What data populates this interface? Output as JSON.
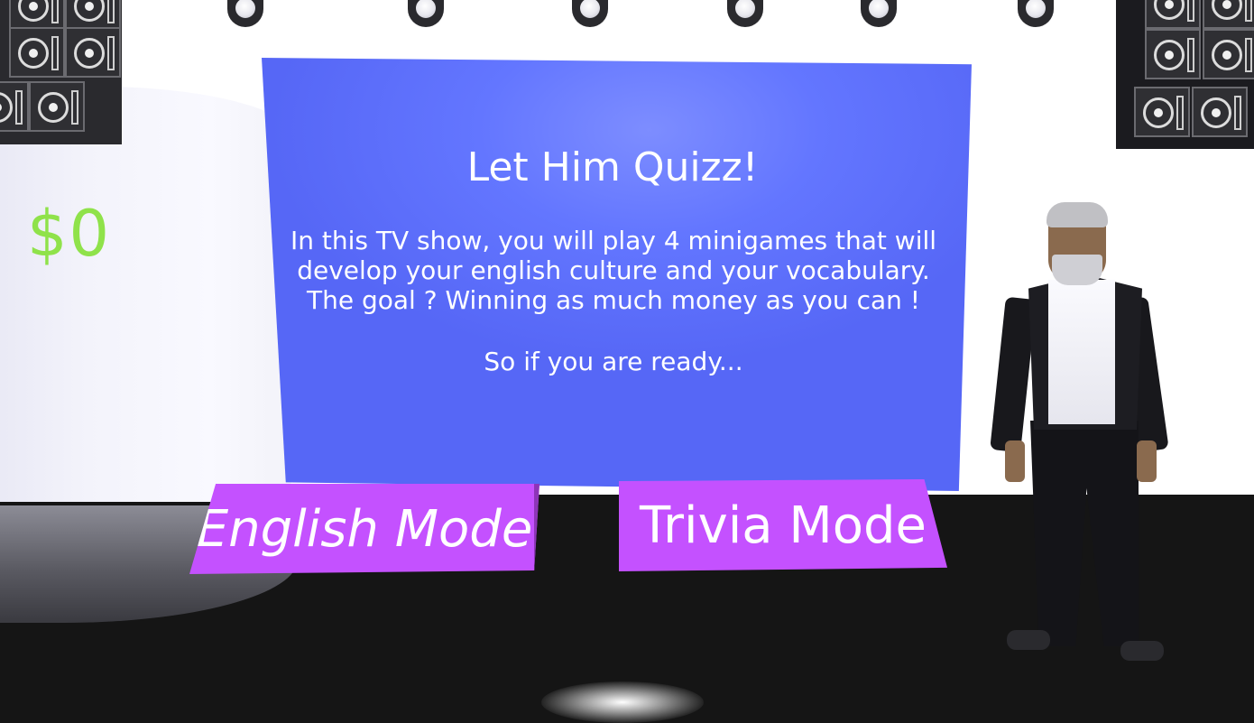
{
  "hud": {
    "money": "$0"
  },
  "screen": {
    "title": "Let Him Quizz!",
    "lines": [
      "In this TV show, you will play 4 minigames that will",
      "develop your english culture and your vocabulary.",
      "The goal ? Winning as much money as you can !"
    ],
    "ready_text": "So if you are ready..."
  },
  "buttons": {
    "english_mode": "English Mode",
    "trivia_mode": "Trivia Mode"
  },
  "colors": {
    "screen_blue": "#6376ff",
    "button_purple": "#c451ff",
    "money_green": "#8fe24a"
  },
  "icons": {
    "stage_lights": "spotlight-icon",
    "speakers": "speaker-icon"
  }
}
